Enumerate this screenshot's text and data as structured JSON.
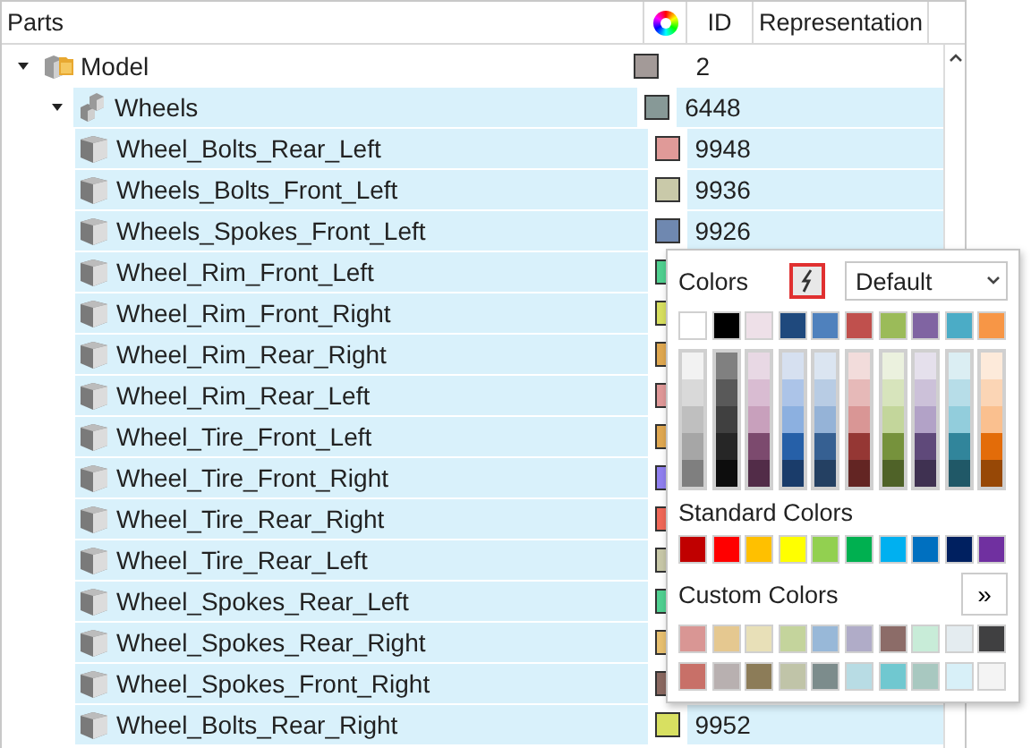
{
  "columns": {
    "parts": "Parts",
    "id": "ID",
    "representation": "Representation"
  },
  "tree": [
    {
      "name": "Model",
      "kind": "model",
      "color": "#a39a98",
      "id": "2",
      "selected": false,
      "expanded": true,
      "children": [
        {
          "name": "Wheels",
          "kind": "assembly",
          "color": "#879997",
          "id": "6448",
          "selected": true,
          "expanded": true,
          "children": [
            {
              "name": "Wheel_Bolts_Rear_Left",
              "kind": "part",
              "color": "#e09a98",
              "id": "9948",
              "selected": true
            },
            {
              "name": "Wheels_Bolts_Front_Left",
              "kind": "part",
              "color": "#c9c9a9",
              "id": "9936",
              "selected": true
            },
            {
              "name": "Wheels_Spokes_Front_Left",
              "kind": "part",
              "color": "#6f88b0",
              "id": "9926",
              "selected": true
            },
            {
              "name": "Wheel_Rim_Front_Left",
              "kind": "part",
              "color": "#50d090",
              "selected": true
            },
            {
              "name": "Wheel_Rim_Front_Right",
              "kind": "part",
              "color": "#d8e060",
              "selected": true
            },
            {
              "name": "Wheel_Rim_Rear_Right",
              "kind": "part",
              "color": "#e0a850",
              "selected": true
            },
            {
              "name": "Wheel_Rim_Rear_Left",
              "kind": "part",
              "color": "#e09898",
              "selected": true
            },
            {
              "name": "Wheel_Tire_Front_Left",
              "kind": "part",
              "color": "#e0a851",
              "selected": true
            },
            {
              "name": "Wheel_Tire_Front_Right",
              "kind": "part",
              "color": "#9080f0",
              "selected": true
            },
            {
              "name": "Wheel_Tire_Rear_Right",
              "kind": "part",
              "color": "#f06858",
              "selected": true
            },
            {
              "name": "Wheel_Tire_Rear_Left",
              "kind": "part",
              "color": "#c8c8a8",
              "selected": true
            },
            {
              "name": "Wheel_Spokes_Rear_Left",
              "kind": "part",
              "color": "#50d091",
              "selected": true
            },
            {
              "name": "Wheel_Spokes_Rear_Right",
              "kind": "part",
              "color": "#e8c070",
              "selected": true
            },
            {
              "name": "Wheel_Spokes_Front_Right",
              "kind": "part",
              "color": "#8a6860",
              "selected": true
            },
            {
              "name": "Wheel_Bolts_Rear_Right",
              "kind": "part",
              "color": "#d8e061",
              "id": "9952",
              "selected": true
            }
          ]
        }
      ]
    }
  ],
  "color_picker": {
    "title": "Colors",
    "lightning_pressed": true,
    "scheme": "Default",
    "theme_colors": [
      {
        "color": "#ffffff"
      },
      {
        "color": "#000000"
      },
      {
        "color": "#eee0e8"
      },
      {
        "color": "#1f497d"
      },
      {
        "color": "#4f81bd"
      },
      {
        "color": "#c0504d"
      },
      {
        "color": "#9bbb59"
      },
      {
        "color": "#8064a2"
      },
      {
        "color": "#4bacc6"
      },
      {
        "color": "#f79646"
      }
    ],
    "shades": [
      {
        "tints": [
          {
            "color": "#f2f2f2"
          },
          {
            "color": "#d9d9d9"
          },
          {
            "color": "#bfbfbf"
          },
          {
            "color": "#a6a6a6"
          },
          {
            "color": "#7f7f7f"
          }
        ]
      },
      {
        "tints": [
          {
            "color": "#808080"
          },
          {
            "color": "#595959"
          },
          {
            "color": "#404040"
          },
          {
            "color": "#262626"
          },
          {
            "color": "#0d0d0d"
          }
        ]
      },
      {
        "tints": [
          {
            "color": "#e8d8e4"
          },
          {
            "color": "#d9bcd2"
          },
          {
            "color": "#c8a0bc"
          },
          {
            "color": "#7c4a6e"
          },
          {
            "color": "#522c48"
          }
        ]
      },
      {
        "tints": [
          {
            "color": "#d6e0f0"
          },
          {
            "color": "#acc4e8"
          },
          {
            "color": "#8cb0e0"
          },
          {
            "color": "#2660a8"
          },
          {
            "color": "#1a3c6a"
          }
        ]
      },
      {
        "tints": [
          {
            "color": "#dbe5f1"
          },
          {
            "color": "#b8cce4"
          },
          {
            "color": "#95b3d7"
          },
          {
            "color": "#366092"
          },
          {
            "color": "#244062"
          }
        ]
      },
      {
        "tints": [
          {
            "color": "#f2dcdb"
          },
          {
            "color": "#e6b9b8"
          },
          {
            "color": "#d99695"
          },
          {
            "color": "#953734"
          },
          {
            "color": "#632523"
          }
        ]
      },
      {
        "tints": [
          {
            "color": "#ebf1de"
          },
          {
            "color": "#d7e4bc"
          },
          {
            "color": "#c3d69b"
          },
          {
            "color": "#76923c"
          },
          {
            "color": "#4f6228"
          }
        ]
      },
      {
        "tints": [
          {
            "color": "#e5e0ec"
          },
          {
            "color": "#ccc1d9"
          },
          {
            "color": "#b2a2c7"
          },
          {
            "color": "#5f497a"
          },
          {
            "color": "#3f3151"
          }
        ]
      },
      {
        "tints": [
          {
            "color": "#dbeef3"
          },
          {
            "color": "#b7dde8"
          },
          {
            "color": "#92cddc"
          },
          {
            "color": "#31859b"
          },
          {
            "color": "#205867"
          }
        ]
      },
      {
        "tints": [
          {
            "color": "#fdeada"
          },
          {
            "color": "#fbd5b5"
          },
          {
            "color": "#fac08f"
          },
          {
            "color": "#e36c09"
          },
          {
            "color": "#974806"
          }
        ]
      }
    ],
    "standard_label": "Standard Colors",
    "standard_colors": [
      {
        "color": "#c00000"
      },
      {
        "color": "#ff0000"
      },
      {
        "color": "#ffc000"
      },
      {
        "color": "#ffff00"
      },
      {
        "color": "#92d050"
      },
      {
        "color": "#00b050"
      },
      {
        "color": "#00b0f0"
      },
      {
        "color": "#0070c0"
      },
      {
        "color": "#002060"
      },
      {
        "color": "#7030a0"
      }
    ],
    "custom_label": "Custom Colors",
    "more": "»",
    "custom_colors": [
      {
        "swatches": [
          {
            "color": "#d99694"
          },
          {
            "color": "#e5c890"
          },
          {
            "color": "#e8e0b8"
          },
          {
            "color": "#c4d49c"
          },
          {
            "color": "#98b8d8"
          },
          {
            "color": "#b0acc8"
          },
          {
            "color": "#8c6c68"
          },
          {
            "color": "#c8ecd8"
          },
          {
            "color": "#e4ecf0"
          },
          {
            "color": "#404041"
          }
        ]
      },
      {
        "swatches": [
          {
            "color": "#c87068"
          },
          {
            "color": "#b8b0b0"
          },
          {
            "color": "#8c7c58"
          },
          {
            "color": "#c0c4a8"
          },
          {
            "color": "#7c8c8c"
          },
          {
            "color": "#b8dce4"
          },
          {
            "color": "#70c8d0"
          },
          {
            "color": "#a8c8c0"
          },
          {
            "color": "#d8f0f8"
          },
          {
            "color": "#f4f4f4"
          }
        ]
      }
    ]
  }
}
